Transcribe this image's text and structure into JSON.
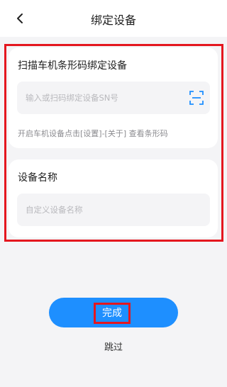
{
  "header": {
    "title": "绑定设备",
    "back_icon": "chevron-left-icon"
  },
  "sn_card": {
    "title": "扫描车机条形码绑定设备",
    "input_placeholder": "输入或扫码绑定设备SN号",
    "scan_icon": "scan-icon",
    "hint": "开启车机设备点击[设置]-[关于] 查看条形码"
  },
  "name_card": {
    "title": "设备名称",
    "input_placeholder": "自定义设备名称"
  },
  "actions": {
    "done_label": "完成",
    "skip_label": "跳过"
  },
  "colors": {
    "accent": "#1e8fff",
    "highlight": "#e4171f",
    "background": "#f4f4f6"
  }
}
